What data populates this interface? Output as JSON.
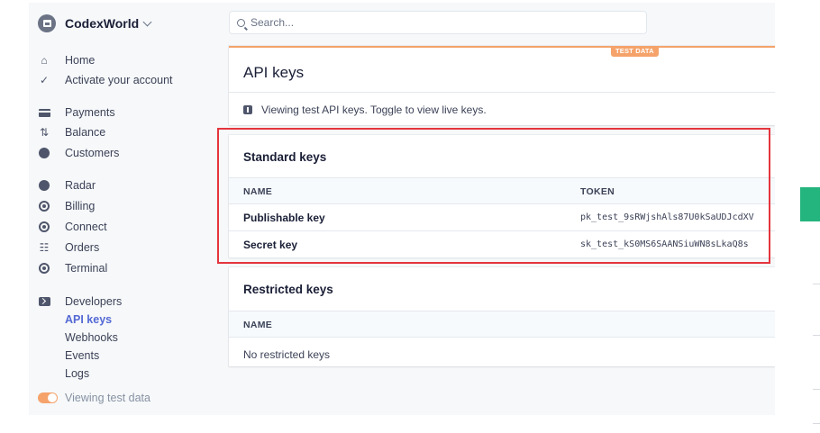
{
  "brand": {
    "name": "CodexWorld"
  },
  "search": {
    "placeholder": "Search..."
  },
  "nav": {
    "home": "Home",
    "activate": "Activate your account",
    "payments": "Payments",
    "balance": "Balance",
    "customers": "Customers",
    "radar": "Radar",
    "billing": "Billing",
    "connect": "Connect",
    "orders": "Orders",
    "terminal": "Terminal",
    "developers": "Developers",
    "dev_items": [
      "API keys",
      "Webhooks",
      "Events",
      "Logs"
    ],
    "toggle_label": "Viewing test data"
  },
  "page": {
    "badge": "TEST DATA",
    "title": "API keys",
    "notice": "Viewing test API keys. Toggle to view live keys."
  },
  "standard_keys": {
    "title": "Standard keys",
    "headers": {
      "name": "NAME",
      "token": "TOKEN"
    },
    "rows": [
      {
        "name": "Publishable key",
        "token": "pk_test_9sRWjshAls87U0kSaUDJcdXV"
      },
      {
        "name": "Secret key",
        "token": "sk_test_kS0MS6SAANSiuWN8sLkaQ8s"
      }
    ]
  },
  "restricted_keys": {
    "title": "Restricted keys",
    "headers": {
      "name": "NAME"
    },
    "empty": "No restricted keys"
  },
  "colors": {
    "accent": "#5469d4",
    "test_badge": "#f5a36b",
    "highlight": "#e4353d",
    "green_tab": "#24b47e"
  }
}
